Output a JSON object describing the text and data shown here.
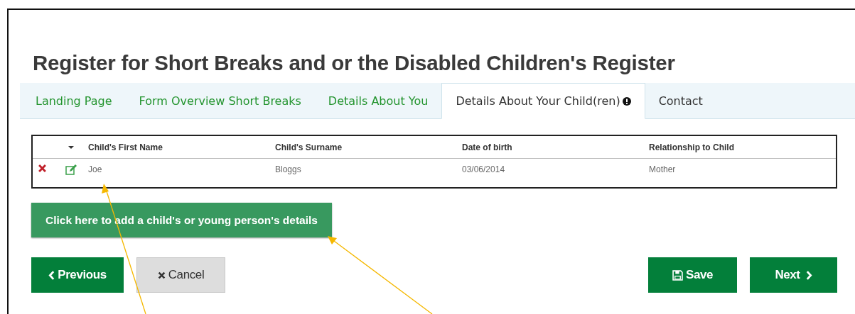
{
  "title": "Register for Short Breaks and or the Disabled Children's Register",
  "tabs": [
    {
      "label": "Landing Page",
      "selected": false,
      "visited": true,
      "alert": false
    },
    {
      "label": "Form Overview Short Breaks",
      "selected": false,
      "visited": true,
      "alert": false
    },
    {
      "label": "Details About You",
      "selected": false,
      "visited": true,
      "alert": false
    },
    {
      "label": "Details About Your Child(ren)",
      "selected": true,
      "visited": true,
      "alert": true
    },
    {
      "label": "Contact",
      "selected": false,
      "visited": false,
      "alert": false
    }
  ],
  "table": {
    "columns": [
      "Child's First Name",
      "Child's Surname",
      "Date of birth",
      "Relationship to Child"
    ],
    "rows": [
      {
        "cells": [
          "Joe",
          "Bloggs",
          "03/06/2014",
          "Mother"
        ]
      }
    ]
  },
  "add_button": "Click here to add a child's or young person's details",
  "buttons": [
    {
      "kind": "previous",
      "label": "Previous"
    },
    {
      "kind": "cancel",
      "label": "Cancel"
    },
    {
      "kind": "save",
      "label": "Save"
    },
    {
      "kind": "next",
      "label": "Next"
    }
  ]
}
